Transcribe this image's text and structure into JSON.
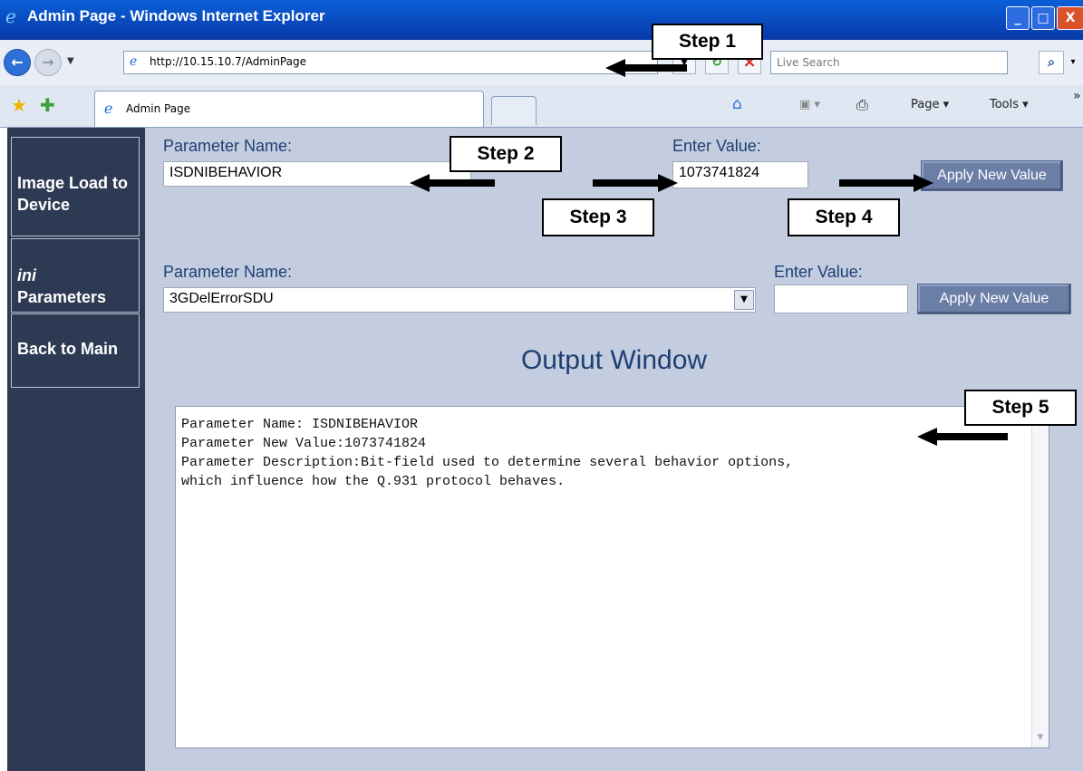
{
  "window": {
    "title": "Admin Page - Windows Internet Explorer",
    "minimize": "_",
    "maximize": "□",
    "close": "X"
  },
  "address_bar": {
    "url": "http://10.15.10.7/AdminPage",
    "search_placeholder": "Live Search"
  },
  "tabs": [
    {
      "label": "Admin Page"
    }
  ],
  "command_bar": {
    "page": "Page ▾",
    "tools": "Tools ▾"
  },
  "sidebar": {
    "items": [
      {
        "label": "Image Load to Device"
      },
      {
        "label_italic": "ini",
        "label": "Parameters"
      },
      {
        "label": "Back to Main"
      }
    ]
  },
  "form1": {
    "param_label": "Parameter Name:",
    "param_value": "ISDNIBEHAVIOR",
    "value_label": "Enter Value:",
    "value": "1073741824",
    "apply": "Apply New Value"
  },
  "form2": {
    "param_label": "Parameter Name:",
    "param_value": "3GDelErrorSDU",
    "value_label": "Enter Value:",
    "value": "",
    "apply": "Apply New Value"
  },
  "output": {
    "title": "Output Window",
    "text": "Parameter Name: ISDNIBEHAVIOR\nParameter New Value:1073741824\nParameter Description:Bit-field used to determine several behavior options,\nwhich influence how the Q.931 protocol behaves."
  },
  "annotations": {
    "step1": "Step 1",
    "step2": "Step 2",
    "step3": "Step 3",
    "step4": "Step 4",
    "step5": "Step 5"
  }
}
